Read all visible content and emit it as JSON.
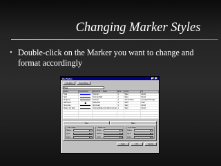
{
  "slide": {
    "title": "Changing Marker Styles",
    "bullet": "Double-click on the Marker you want to change and format accordingly"
  },
  "dialog": {
    "title": "Bar Styles",
    "buttons": [
      "Cut Row",
      "Insert Row"
    ],
    "edit_value": "Task",
    "columns": [
      "Name",
      "Appearance",
      "Show For ... Tasks",
      "Row",
      "From",
      "To"
    ],
    "rows": [
      {
        "name": "Task",
        "show": "Normal",
        "row": "1",
        "from": "Start",
        "to": "Finish",
        "color": "#0000ff",
        "weight": "bar"
      },
      {
        "name": "Split",
        "show": "Normal,Split",
        "row": "1",
        "from": "Start",
        "to": "Finish",
        "color": "#000000",
        "weight": "line"
      },
      {
        "name": "Progress",
        "show": "Normal",
        "row": "1",
        "from": "Actual Start",
        "to": "CompleteThrough",
        "color": "#000000",
        "weight": "line"
      },
      {
        "name": "Milestone",
        "show": "Milestone",
        "row": "1",
        "from": "Start",
        "to": "Start",
        "color": "#000000",
        "weight": "diamond"
      },
      {
        "name": "Summary",
        "show": "Summary",
        "row": "1",
        "from": "Start",
        "to": "Finish",
        "color": "#000000",
        "weight": "bar"
      },
      {
        "name": "Rolled Up Task",
        "show": "Normal,Rolled Up,Not Summary",
        "row": "1",
        "from": "Start",
        "to": "Finish",
        "color": "#000000",
        "weight": "line"
      },
      {
        "name": "",
        "show": "",
        "row": "",
        "from": "",
        "to": "",
        "color": "",
        "weight": ""
      },
      {
        "name": "",
        "show": "",
        "row": "",
        "from": "",
        "to": "",
        "color": "",
        "weight": ""
      },
      {
        "name": "",
        "show": "",
        "row": "",
        "from": "",
        "to": "",
        "color": "",
        "weight": ""
      },
      {
        "name": "",
        "show": "",
        "row": "",
        "from": "",
        "to": "",
        "color": "",
        "weight": ""
      }
    ],
    "tabs": [
      "Text",
      "Bars"
    ],
    "groups": [
      {
        "title": "Start shape",
        "fields": [
          "Shape:",
          "Type:",
          "Color:"
        ],
        "fill": [
          "#ffffff",
          "#ffffff",
          "#000000"
        ]
      },
      {
        "title": "Middle bar",
        "fields": [
          "Shape:",
          "Pattern:",
          "Color:"
        ],
        "fill": [
          "#808080",
          "#808080",
          "#0000ff"
        ]
      },
      {
        "title": "End shape",
        "fields": [
          "Shape:",
          "Type:",
          "Color:"
        ],
        "fill": [
          "#ffffff",
          "#ffffff",
          "#000000"
        ]
      }
    ],
    "bottom_buttons": [
      "Help",
      "OK",
      "Cancel"
    ]
  }
}
